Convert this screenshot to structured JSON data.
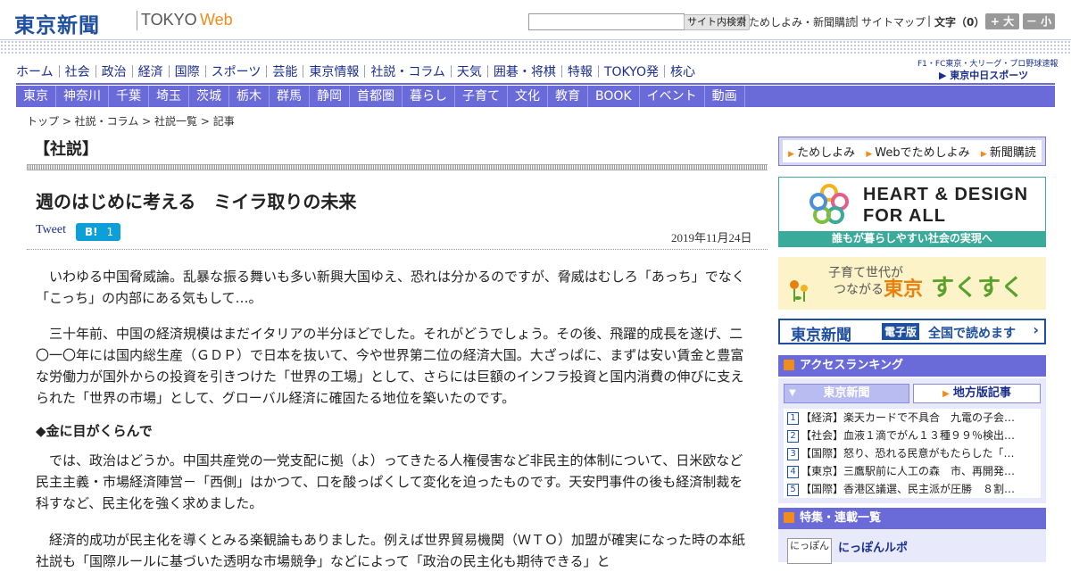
{
  "header": {
    "logo_ja": "東京新聞",
    "logo_tokyo": "TOKYO",
    "logo_web": "Web",
    "search_button": "サイト内検索",
    "link_trial": "ためしよみ・新聞購読",
    "link_sitemap": "サイトマップ",
    "font_label": "文字（0）",
    "font_larger": "+ 大",
    "font_smaller": "－ 小"
  },
  "nav_main": [
    "ホーム",
    "社会",
    "政治",
    "経済",
    "国際",
    "スポーツ",
    "芸能",
    "東京情報",
    "社説・コラム",
    "天気",
    "囲碁・将棋",
    "特報",
    "TOKYO発",
    "核心"
  ],
  "sports_link": {
    "line1": "F1・FC東京・大リーグ・プロ野球速報",
    "line2": "▶ 東京中日スポーツ"
  },
  "nav_region": [
    "東京",
    "神奈川",
    "千葉",
    "埼玉",
    "茨城",
    "栃木",
    "群馬",
    "静岡",
    "首都圏",
    "暮らし",
    "子育て",
    "文化",
    "教育",
    "BOOK",
    "イベント",
    "動画"
  ],
  "breadcrumb": "トップ > 社説・コラム > 社説一覧 > 記事",
  "article": {
    "section_label": "【社説】",
    "title": "週のはじめに考える　ミイラ取りの未来",
    "tweet": "Tweet",
    "hatena_count": "1",
    "hatena_label": "B!",
    "date": "2019年11月24日",
    "paragraphs": [
      "いわゆる中国脅威論。乱暴な振る舞いも多い新興大国ゆえ、恐れは分かるのですが、脅威はむしろ「あっち」でなく「こっち」の内部にある気もして…。",
      "三十年前、中国の経済規模はまだイタリアの半分ほどでした。それがどうでしょう。その後、飛躍的成長を遂げ、二〇一〇年には国内総生産（ＧＤＰ）で日本を抜いて、今や世界第二位の経済大国。大ざっぱに、まずは安い賃金と豊富な労働力が国外からの投資を引きつけた「世界の工場」として、さらには巨額のインフラ投資と国内消費の伸びに支えられた「世界の市場」として、グローバル経済に確固たる地位を築いたのです。",
      "では、政治はどうか。中国共産党の一党支配に拠（よ）ってきたる人権侵害など非民主的体制について、日米欧など民主主義・市場経済陣営－「西側」はかつて、口を酸っぱくして変化を迫ったものです。天安門事件の後も経済制裁を科すなど、民主化を強く求めました。",
      "経済的成功が民主化を導くとみる楽観論もありました。例えば世界貿易機関（ＷＴＯ）加盟が確実になった時の本紙社説も「国際ルールに基づいた透明な市場競争」などによって「政治の民主化も期待できる」と"
    ],
    "subhead": "◆金に目がくらんで"
  },
  "sidebar": {
    "buttons": [
      "ためしよみ",
      "Webでためしよみ",
      "新聞購読"
    ],
    "hd_line1": "HEART & DESIGN",
    "hd_line2": "FOR ALL",
    "hd_bar": "誰もが暮らしやすい社会の実現へ",
    "sk_sub1": "子育て世代が",
    "sk_sub2": "つながる",
    "sk_tokyo": "東京",
    "sk_main": "すくすく",
    "ep_logo": "東京新聞",
    "ep_badge": "電子版",
    "ep_text": "全国で読めます",
    "ranking_title": "アクセスランキング",
    "rank_tab_active": "東京新聞",
    "rank_tab_other": "地方版記事",
    "ranking": [
      {
        "num": "1",
        "text": "【経済】楽天カードで不具合　九電の子会…"
      },
      {
        "num": "2",
        "text": "【社会】血液１滴でがん１３種９９％検出…"
      },
      {
        "num": "3",
        "text": "【国際】怒り、恐れる民意がもたらした「…"
      },
      {
        "num": "4",
        "text": "【東京】三鷹駅前に人工の森　市、再開発…"
      },
      {
        "num": "5",
        "text": "【国際】香港区議選、民主派が圧勝　８割…"
      }
    ],
    "features_title": "特集・連載一覧",
    "feature_thumb": "にっぽん",
    "feature_item": "にっぽんルポ"
  }
}
